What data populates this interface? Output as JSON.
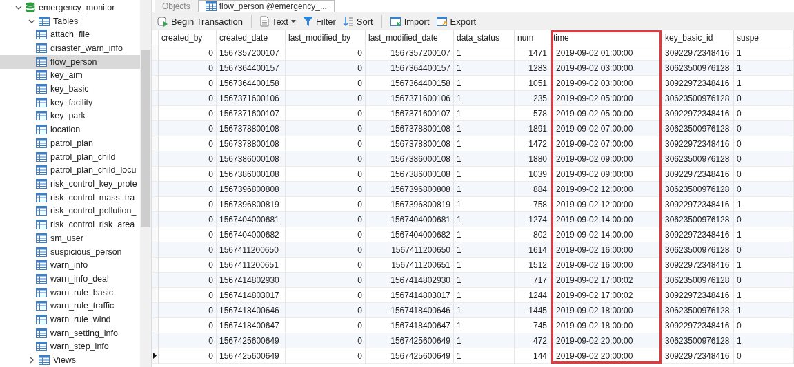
{
  "sidebar": {
    "database": {
      "label": "emergency_monitor",
      "expanded": true
    },
    "tables_group": {
      "label": "Tables",
      "expanded": true
    },
    "items": [
      {
        "label": "attach_file",
        "selected": false
      },
      {
        "label": "disaster_warn_info",
        "selected": false
      },
      {
        "label": "flow_person",
        "selected": true
      },
      {
        "label": "key_aim",
        "selected": false
      },
      {
        "label": "key_basic",
        "selected": false
      },
      {
        "label": "key_facility",
        "selected": false
      },
      {
        "label": "key_park",
        "selected": false
      },
      {
        "label": "location",
        "selected": false
      },
      {
        "label": "patrol_plan",
        "selected": false
      },
      {
        "label": "patrol_plan_child",
        "selected": false
      },
      {
        "label": "patrol_plan_child_locu",
        "selected": false
      },
      {
        "label": "risk_control_key_prote",
        "selected": false
      },
      {
        "label": "risk_control_mass_tra",
        "selected": false
      },
      {
        "label": "risk_control_pollution_",
        "selected": false
      },
      {
        "label": "risk_control_risk_area",
        "selected": false
      },
      {
        "label": "sm_user",
        "selected": false
      },
      {
        "label": "suspicious_person",
        "selected": false
      },
      {
        "label": "warn_info",
        "selected": false
      },
      {
        "label": "warn_info_deal",
        "selected": false
      },
      {
        "label": "warn_rule_basic",
        "selected": false
      },
      {
        "label": "warn_rule_traffic",
        "selected": false
      },
      {
        "label": "warn_rule_wind",
        "selected": false
      },
      {
        "label": "warn_setting_info",
        "selected": false
      },
      {
        "label": "warn_step_info",
        "selected": false
      }
    ],
    "views_group": {
      "label": "Views",
      "expanded": false
    }
  },
  "tabs": [
    {
      "label": "Objects",
      "selected": false
    },
    {
      "label": "flow_person @emergency_...",
      "selected": true
    }
  ],
  "toolbar": [
    {
      "kind": "transaction",
      "label": "Begin Transaction"
    },
    {
      "kind": "text",
      "label": "Text"
    },
    {
      "kind": "filter",
      "label": "Filter"
    },
    {
      "kind": "sort",
      "label": "Sort"
    },
    {
      "kind": "import",
      "label": "Import"
    },
    {
      "kind": "export",
      "label": "Export"
    }
  ],
  "table": {
    "columns": [
      {
        "label": "created_by",
        "kind": "numeric",
        "highlighted": false
      },
      {
        "label": "created_date",
        "kind": "text",
        "highlighted": false
      },
      {
        "label": "last_modified_by",
        "kind": "numeric",
        "highlighted": false
      },
      {
        "label": "last_modified_date",
        "kind": "numeric",
        "highlighted": false
      },
      {
        "label": "data_status",
        "kind": "text",
        "highlighted": false
      },
      {
        "label": "num",
        "kind": "numeric",
        "highlighted": false
      },
      {
        "label": "time",
        "kind": "text",
        "highlighted": true
      },
      {
        "label": "key_basic_id",
        "kind": "text",
        "highlighted": false
      },
      {
        "label": "suspe",
        "kind": "text",
        "highlighted": false
      }
    ],
    "rows": [
      {
        "selected": false,
        "cells": [
          "0",
          "1567357200107",
          "0",
          "1567357200107",
          "1",
          "1471",
          "2019-09-02 01:00:00",
          "30922972348416",
          "1"
        ]
      },
      {
        "selected": false,
        "cells": [
          "0",
          "1567364400157",
          "0",
          "1567364400157",
          "1",
          "1283",
          "2019-09-02 03:00:00",
          "30623500976128",
          "1"
        ]
      },
      {
        "selected": false,
        "cells": [
          "0",
          "1567364400158",
          "0",
          "1567364400158",
          "1",
          "1051",
          "2019-09-02 03:00:00",
          "30922972348416",
          "1"
        ]
      },
      {
        "selected": false,
        "cells": [
          "0",
          "1567371600106",
          "0",
          "1567371600106",
          "1",
          "235",
          "2019-09-02 05:00:00",
          "30623500976128",
          "0"
        ]
      },
      {
        "selected": false,
        "cells": [
          "0",
          "1567371600107",
          "0",
          "1567371600107",
          "1",
          "578",
          "2019-09-02 05:00:00",
          "30922972348416",
          "0"
        ]
      },
      {
        "selected": false,
        "cells": [
          "0",
          "1567378800108",
          "0",
          "1567378800108",
          "1",
          "1891",
          "2019-09-02 07:00:00",
          "30623500976128",
          "0"
        ]
      },
      {
        "selected": false,
        "cells": [
          "0",
          "1567378800108",
          "0",
          "1567378800108",
          "1",
          "1472",
          "2019-09-02 07:00:00",
          "30922972348416",
          "0"
        ]
      },
      {
        "selected": false,
        "cells": [
          "0",
          "1567386000108",
          "0",
          "1567386000108",
          "1",
          "1880",
          "2019-09-02 09:00:00",
          "30623500976128",
          "0"
        ]
      },
      {
        "selected": false,
        "cells": [
          "0",
          "1567386000108",
          "0",
          "1567386000108",
          "1",
          "1039",
          "2019-09-02 09:00:00",
          "30922972348416",
          "0"
        ]
      },
      {
        "selected": false,
        "cells": [
          "0",
          "1567396800808",
          "0",
          "1567396800808",
          "1",
          "884",
          "2019-09-02 12:00:00",
          "30623500976128",
          "0"
        ]
      },
      {
        "selected": false,
        "cells": [
          "0",
          "1567396800819",
          "0",
          "1567396800819",
          "1",
          "758",
          "2019-09-02 12:00:00",
          "30922972348416",
          "1"
        ]
      },
      {
        "selected": false,
        "cells": [
          "0",
          "1567404000681",
          "0",
          "1567404000681",
          "1",
          "1274",
          "2019-09-02 14:00:00",
          "30623500976128",
          "0"
        ]
      },
      {
        "selected": false,
        "cells": [
          "0",
          "1567404000682",
          "0",
          "1567404000682",
          "1",
          "802",
          "2019-09-02 14:00:00",
          "30922972348416",
          "1"
        ]
      },
      {
        "selected": false,
        "cells": [
          "0",
          "1567411200650",
          "0",
          "1567411200650",
          "1",
          "1614",
          "2019-09-02 16:00:00",
          "30623500976128",
          "0"
        ]
      },
      {
        "selected": false,
        "cells": [
          "0",
          "1567411200651",
          "0",
          "1567411200651",
          "1",
          "1512",
          "2019-09-02 16:00:00",
          "30922972348416",
          "1"
        ]
      },
      {
        "selected": false,
        "cells": [
          "0",
          "1567414802930",
          "0",
          "1567414802930",
          "1",
          "717",
          "2019-09-02 17:00:02",
          "30623500976128",
          "0"
        ]
      },
      {
        "selected": false,
        "cells": [
          "0",
          "1567414803017",
          "0",
          "1567414803017",
          "1",
          "1244",
          "2019-09-02 17:00:02",
          "30922972348416",
          "1"
        ]
      },
      {
        "selected": false,
        "cells": [
          "0",
          "1567418400646",
          "0",
          "1567418400646",
          "1",
          "1445",
          "2019-09-02 18:00:00",
          "30623500976128",
          "1"
        ]
      },
      {
        "selected": false,
        "cells": [
          "0",
          "1567418400647",
          "0",
          "1567418400647",
          "1",
          "745",
          "2019-09-02 18:00:00",
          "30922972348416",
          "0"
        ]
      },
      {
        "selected": false,
        "cells": [
          "0",
          "1567425600649",
          "0",
          "1567425600649",
          "1",
          "472",
          "2019-09-02 20:00:00",
          "30623500976128",
          "1"
        ]
      },
      {
        "selected": true,
        "cells": [
          "0",
          "1567425600649",
          "0",
          "1567425600649",
          "1",
          "144",
          "2019-09-02 20:00:00",
          "30922972348416",
          "0"
        ]
      }
    ]
  }
}
